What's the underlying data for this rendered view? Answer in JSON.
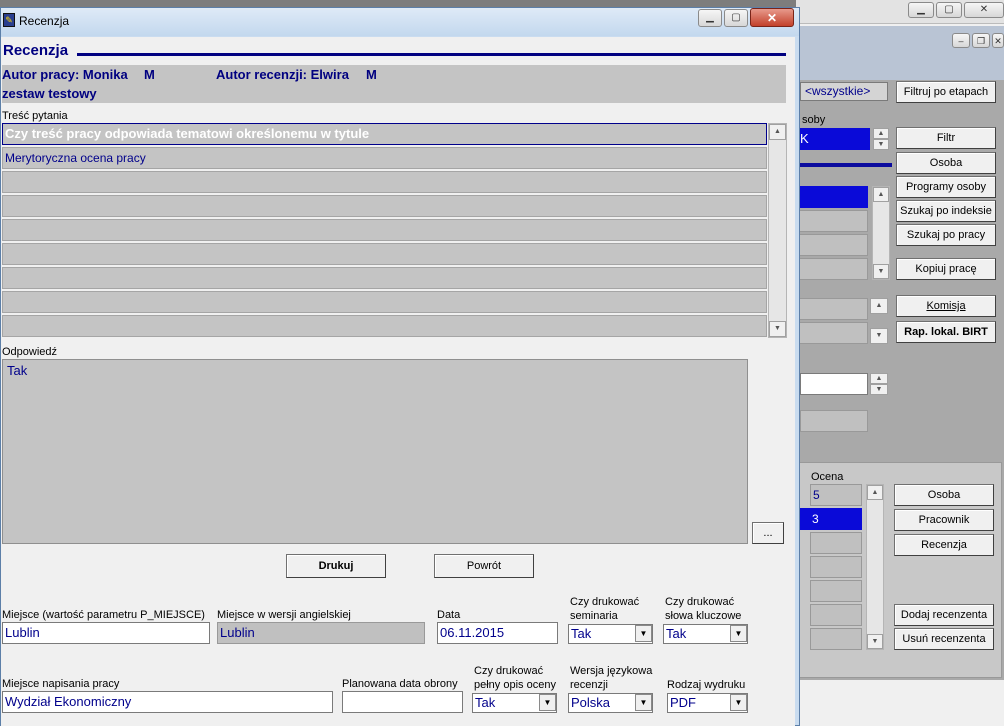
{
  "background_app": {
    "filter_value": "<wszystkie>",
    "buttons": {
      "filter_by_stage": "Filtruj po etapach",
      "filter": "Filtr",
      "person": "Osoba",
      "person_programs": "Programy osoby",
      "search_by_index": "Szukaj po indeksie",
      "search_by_thesis": "Szukaj po pracy",
      "copy_thesis": "Kopiuj pracę",
      "committee": "Komisja",
      "birt_report": "Rap. lokal. BIRT",
      "person2": "Osoba",
      "employee": "Pracownik",
      "review": "Recenzja",
      "add_reviewer": "Dodaj recenzenta",
      "remove_reviewer": "Usuń recenzenta"
    },
    "osoby_fragment": "soby",
    "selected_fragment": "K",
    "grade_header": "Ocena",
    "grades": [
      "5",
      "3"
    ]
  },
  "dialog": {
    "title": "Recenzja",
    "heading": "Recenzja",
    "author_label": "Autor pracy: Monika",
    "author_initial": "M",
    "reviewer_label": "Autor recenzji: Elwira",
    "reviewer_initial": "M",
    "set_name": "zestaw testowy",
    "question_section_label": "Treść pytania",
    "questions": [
      "Czy treść pracy odpowiada tematowi określonemu w tytule",
      "Merytoryczna ocena pracy",
      "",
      "",
      "",
      "",
      "",
      "",
      "",
      ""
    ],
    "answer_label": "Odpowiedź",
    "answer_value": "Tak",
    "ellipsis_button": "...",
    "print_button": "Drukuj",
    "back_button": "Powrót",
    "fields": {
      "place_label": "Miejsce (wartość parametru P_MIEJSCE)",
      "place_value": "Lublin",
      "place_en_label": "Miejsce w wersji angielskiej",
      "place_en_value": "Lublin",
      "date_label": "Data",
      "date_value": "06.11.2015",
      "print_seminars_label_1": "Czy drukować",
      "print_seminars_label_2": "seminaria",
      "print_seminars_value": "Tak",
      "print_keywords_label_1": "Czy drukować",
      "print_keywords_label_2": "słowa kluczowe",
      "print_keywords_value": "Tak",
      "writing_place_label": "Miejsce napisania pracy",
      "writing_place_value": "Wydział Ekonomiczny",
      "planned_defense_label": "Planowana data obrony",
      "planned_defense_value": "",
      "print_full_label_1": "Czy drukować",
      "print_full_label_2": "pełny opis oceny",
      "print_full_value": "Tak",
      "language_label_1": "Wersja językowa",
      "language_label_2": "recenzji",
      "language_value": "Polska",
      "output_label": "Rodzaj wydruku",
      "output_value": "PDF"
    }
  }
}
